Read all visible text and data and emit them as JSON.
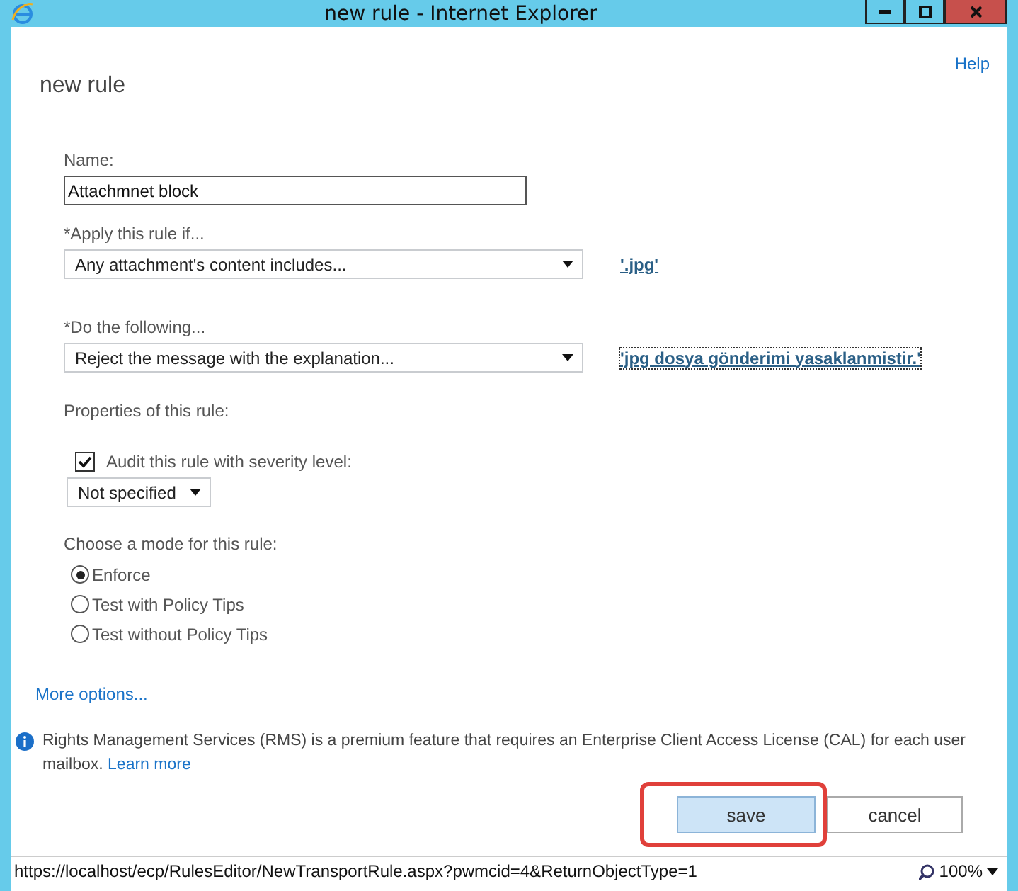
{
  "window": {
    "title": "new rule - Internet Explorer"
  },
  "help_link": "Help",
  "heading": "new rule",
  "name_field": {
    "label": "Name:",
    "value": "Attachmnet block"
  },
  "conditions": [
    {
      "label": "*Apply this rule if...",
      "value": "Any attachment's content includes...",
      "link": "'.jpg'",
      "focused": false
    },
    {
      "label": "*Do the following...",
      "value": "Reject the message with the explanation...",
      "link": "'jpg dosya gönderimi yasaklanmistir.'",
      "focused": true
    }
  ],
  "properties": {
    "label": "Properties of this rule:",
    "audit": {
      "label": "Audit this rule with severity level:",
      "checked": true
    },
    "severity": "Not specified"
  },
  "mode": {
    "label": "Choose a mode for this rule:",
    "options": [
      {
        "label": "Enforce",
        "selected": true
      },
      {
        "label": "Test with Policy Tips",
        "selected": false
      },
      {
        "label": "Test without Policy Tips",
        "selected": false
      }
    ]
  },
  "more_options": "More options...",
  "info": {
    "text": "Rights Management Services (RMS) is a premium feature that requires an Enterprise Client Access License (CAL) for each user mailbox.",
    "link": "Learn more"
  },
  "buttons": [
    {
      "label": "save",
      "primary": true,
      "highlighted": true
    },
    {
      "label": "cancel",
      "primary": false,
      "highlighted": false
    }
  ],
  "status_bar": {
    "url": "https://localhost/ecp/RulesEditor/NewTransportRule.aspx?pwmcid=4&ReturnObjectType=1",
    "zoom": "100%"
  }
}
